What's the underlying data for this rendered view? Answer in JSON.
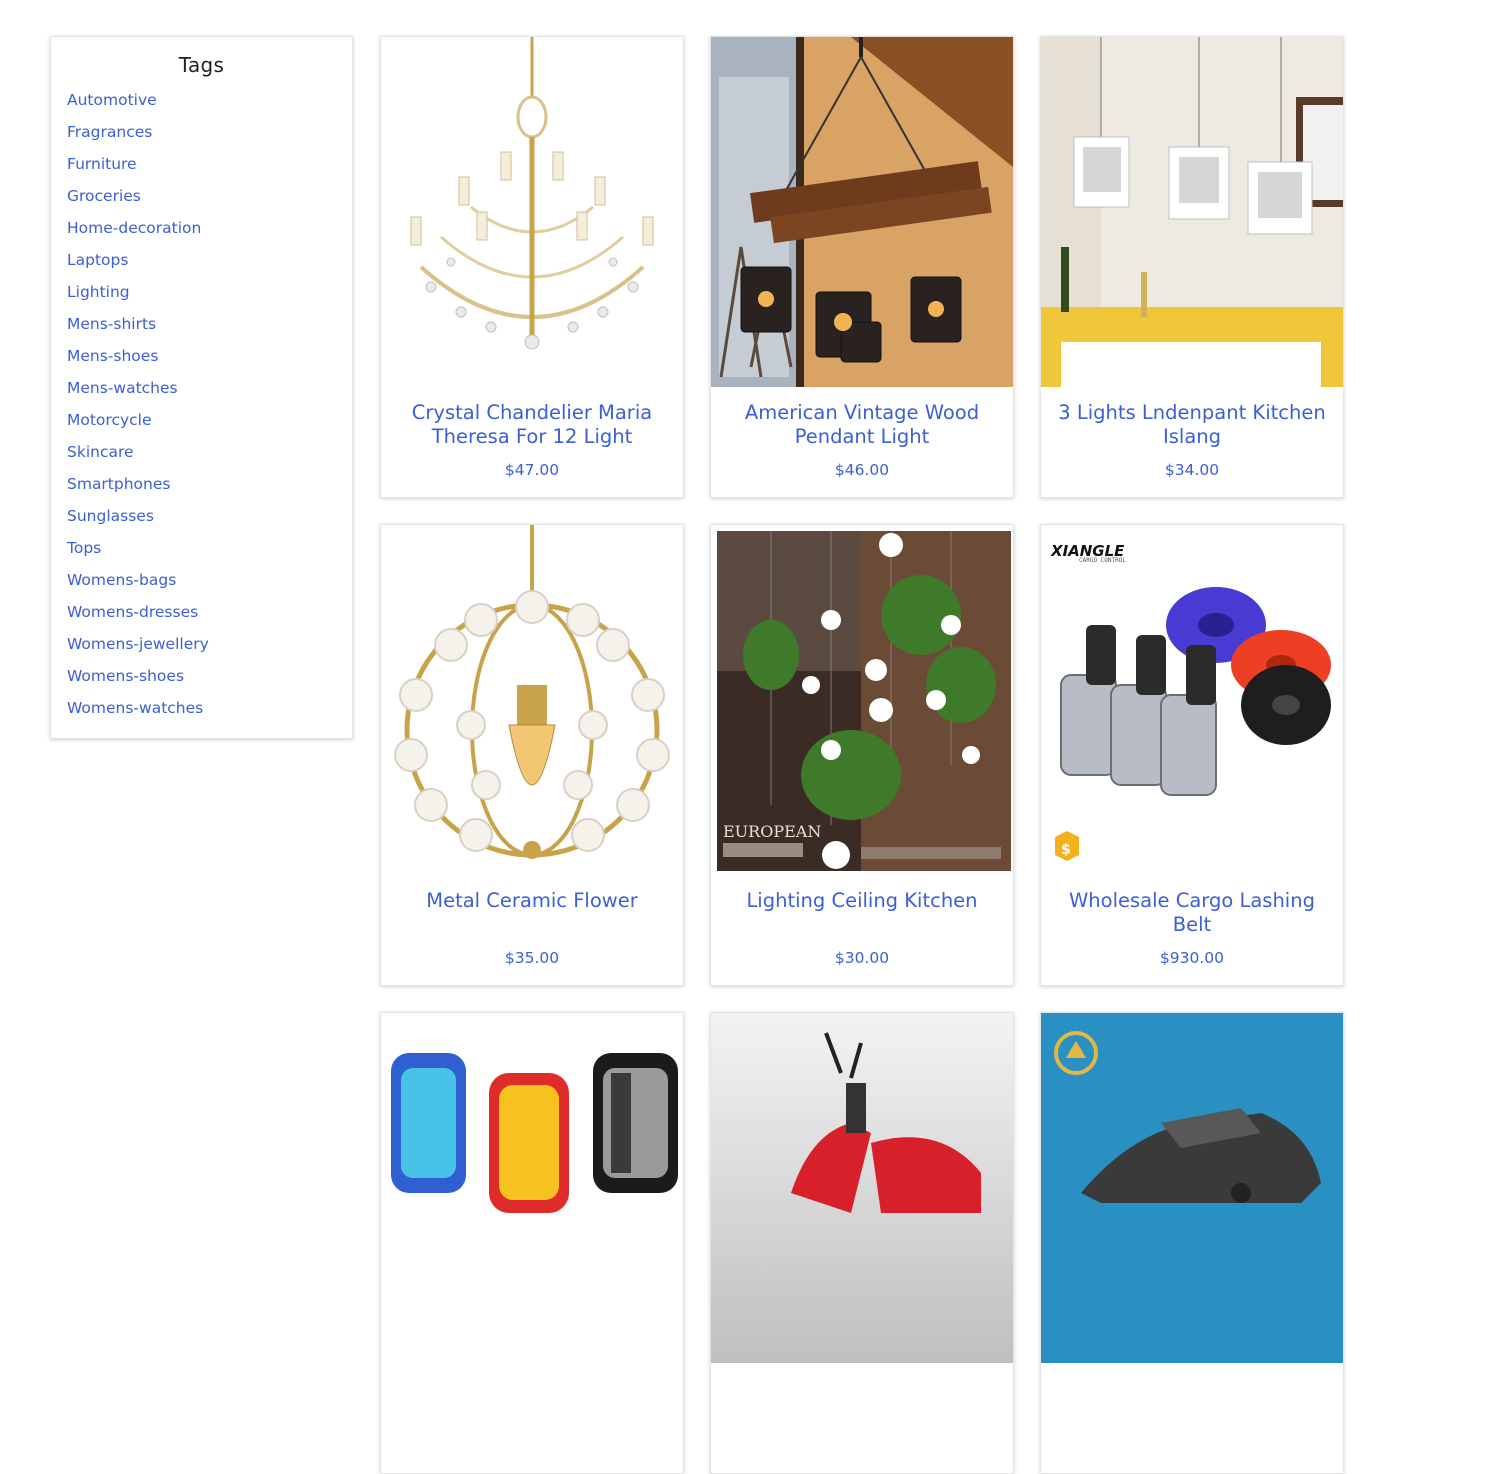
{
  "sidebar": {
    "title": "Tags",
    "tags": [
      "Automotive",
      "Fragrances",
      "Furniture",
      "Groceries",
      "Home-decoration",
      "Laptops",
      "Lighting",
      "Mens-shirts",
      "Mens-shoes",
      "Mens-watches",
      "Motorcycle",
      "Skincare",
      "Smartphones",
      "Sunglasses",
      "Tops",
      "Womens-bags",
      "Womens-dresses",
      "Womens-jewellery",
      "Womens-shoes",
      "Womens-watches"
    ]
  },
  "products": [
    {
      "name": "Crystal Chandelier Maria Theresa For 12 Light",
      "price": "$47.00",
      "image": "chandelier-image"
    },
    {
      "name": "American Vintage Wood Pendant Light",
      "price": "$46.00",
      "image": "wood-pendant-image"
    },
    {
      "name": "3 Lights Lndenpant Kitchen Islang",
      "price": "$34.00",
      "image": "kitchen-pendant-image"
    },
    {
      "name": "Metal Ceramic Flower",
      "price": "$35.00",
      "image": "ceramic-flower-image"
    },
    {
      "name": "Lighting Ceiling Kitchen",
      "price": "$30.00",
      "image": "ceiling-lights-image",
      "image_text": "EUROPEAN"
    },
    {
      "name": "Wholesale Cargo Lashing Belt",
      "price": "$930.00",
      "image": "cargo-belt-image",
      "brand_text": "XIANGLE",
      "brand_sub": "CARGO CONTROL"
    },
    {
      "name": "",
      "price": "",
      "image": "goggles-image"
    },
    {
      "name": "",
      "price": "",
      "image": "scooter-image"
    },
    {
      "name": "",
      "price": "",
      "image": "motorcycle-image"
    }
  ],
  "colors": {
    "link": "#3a5fd6",
    "card_border": "#e4e4e4",
    "gold": "#c9a34a"
  }
}
